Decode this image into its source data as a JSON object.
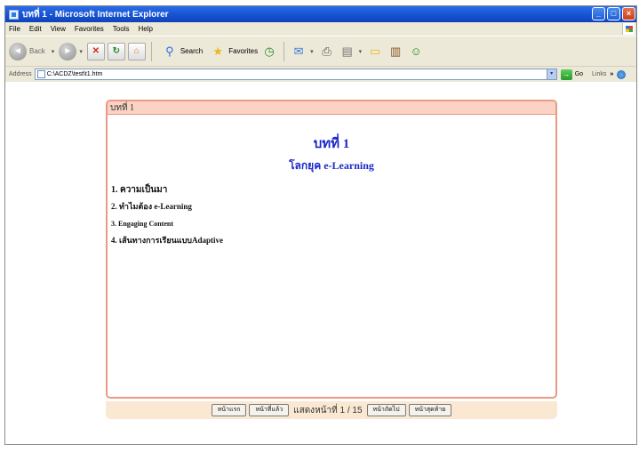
{
  "window": {
    "title": "บทที่ 1 - Microsoft Internet Explorer",
    "buttons": {
      "minimize": "_",
      "maximize": "□",
      "close": "×"
    }
  },
  "menu": {
    "items": [
      "File",
      "Edit",
      "View",
      "Favorites",
      "Tools",
      "Help"
    ]
  },
  "toolbar": {
    "back_label": "Back",
    "back_glyph": "◄",
    "forward_glyph": "►",
    "caret_glyph": "▾",
    "stop_glyph": "✕",
    "refresh_glyph": "↻",
    "home_glyph": "⌂",
    "search_glyph": "⚲",
    "search_label": "Search",
    "favorites_glyph": "★",
    "favorites_label": "Favorites",
    "history_glyph": "◷",
    "mail_glyph": "✉",
    "print_glyph": "⎙",
    "edit_glyph": "▤",
    "folder_glyph": "▭",
    "research_glyph": "▥",
    "messenger_glyph": "☺"
  },
  "address": {
    "label": "Address",
    "value": "C:\\ACDZ\\test\\t1.htm",
    "dropdown_glyph": "▾",
    "go_glyph": "→",
    "go_label": "Go",
    "links_label": "Links",
    "links_more": "»"
  },
  "lesson": {
    "header": "บทที่ 1",
    "title": "บทที่ 1",
    "subtitle": "โลกยุค e-Learning",
    "topics": [
      "1. ความเป็นมา",
      "2. ทำไมต้อง e-Learning",
      "3. Engaging Content",
      "4. เส้นทางการเรียนแบบAdaptive"
    ]
  },
  "nav": {
    "first": "หน้าแรก",
    "prev": "หน้าที่แล้ว",
    "page_info": "แสดงหน้าที่ 1 / 15",
    "next": "หน้าถัดไป",
    "last": "หน้าสุดท้าย"
  },
  "colors": {
    "accent_title": "#1a28c8",
    "card_border": "#e89a86",
    "card_header_bg": "#fbd2c4",
    "nav_bg": "#fbe8d2"
  }
}
